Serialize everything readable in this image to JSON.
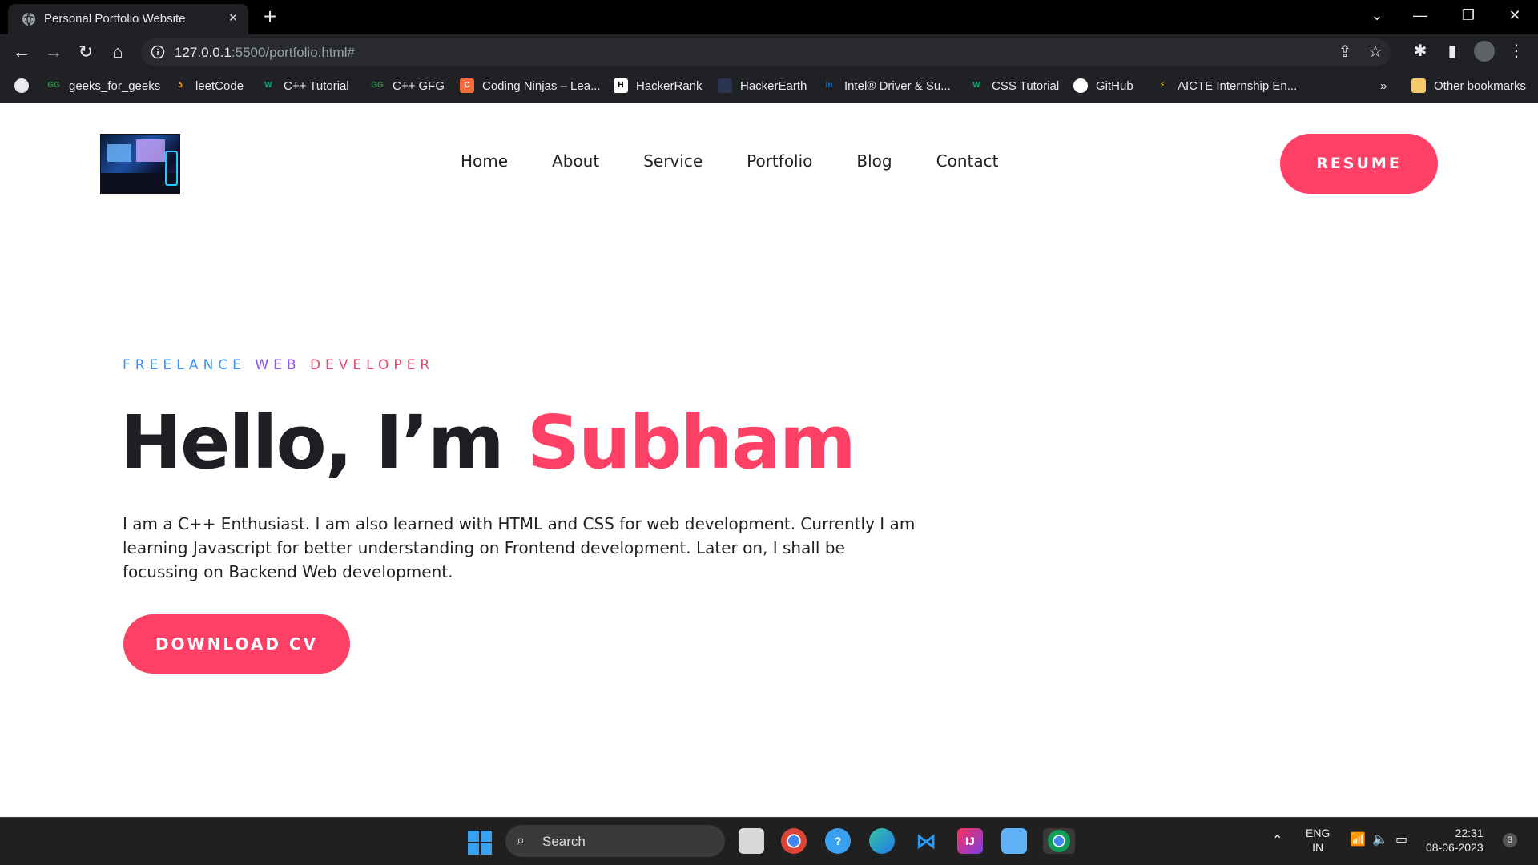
{
  "browser": {
    "tab_title": "Personal Portfolio Website",
    "tab_close": "×",
    "new_tab": "+",
    "url_host": "127.0.0.1",
    "url_rest": ":5500/portfolio.html#",
    "bookmarks": [
      {
        "label": "geeks_for_geeks",
        "icon": "gfg-icon",
        "color": "#2f8d46"
      },
      {
        "label": "leetCode",
        "icon": "leetcode-icon",
        "color": "#ffa116"
      },
      {
        "label": "C++ Tutorial",
        "icon": "w3schools-icon",
        "color": "#04aa6d"
      },
      {
        "label": "C++ GFG",
        "icon": "gfg-icon",
        "color": "#2f8d46"
      },
      {
        "label": "Coding Ninjas – Lea...",
        "icon": "coding-ninjas-icon",
        "color": "#f66c3b"
      },
      {
        "label": "HackerRank",
        "icon": "hackerrank-icon",
        "color": "#1ba94c"
      },
      {
        "label": "HackerEarth",
        "icon": "hackerearth-icon",
        "color": "#2c3454"
      },
      {
        "label": "Intel® Driver & Su...",
        "icon": "intel-icon",
        "color": "#0071c5"
      },
      {
        "label": "CSS Tutorial",
        "icon": "w3schools-icon",
        "color": "#04aa6d"
      },
      {
        "label": "GitHub",
        "icon": "github-icon",
        "color": "#ffffff"
      },
      {
        "label": "AICTE Internship En...",
        "icon": "aicte-icon",
        "color": "#f5c400"
      }
    ],
    "more_bookmarks": "»",
    "other_bookmarks": "Other bookmarks"
  },
  "site": {
    "nav": [
      "Home",
      "About",
      "Service",
      "Portfolio",
      "Blog",
      "Contact"
    ],
    "resume_label": "RESUME",
    "tagline": {
      "w1": "FREELANCE",
      "w2": "WEB",
      "w3": "DEVELOPER"
    },
    "headline_prefix": "Hello, I’m ",
    "headline_name": "Subham",
    "intro": "I am a C++ Enthusiast. I am also learned with HTML and CSS for web development. Currently I am learning Javascript for better understanding on Frontend development. Later on, I shall be focussing on Backend Web development.",
    "download_label": "DOWNLOAD CV",
    "accent": "#fe4066"
  },
  "taskbar": {
    "search_label": "Search",
    "lang": "ENG",
    "region": "IN",
    "time": "22:31",
    "date": "08-06-2023",
    "notifications": "3"
  }
}
